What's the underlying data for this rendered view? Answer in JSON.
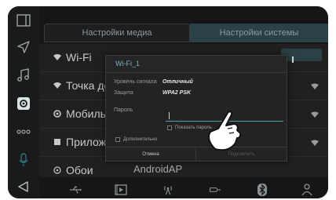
{
  "tabs": {
    "media": "Настройки медиа",
    "system": "Настройки системы"
  },
  "settings_list": {
    "items": [
      {
        "label": "Wi-Fi"
      },
      {
        "label": "Точка до"
      },
      {
        "label": "Мобильн"
      },
      {
        "label": "Приложе"
      },
      {
        "label": "Обои"
      }
    ],
    "network_name": "AndroidAP"
  },
  "dialog": {
    "title": "Wi-Fi_1",
    "signal_label": "Уровень сигнала",
    "signal_value": "Отличный",
    "security_label": "Защита",
    "security_value": "WPA2 PSK",
    "password_label": "Пароль",
    "password_value": "",
    "show_password_label": "Показать пароль",
    "advanced_label": "Дополнительно",
    "cancel_label": "Отмена",
    "connect_label": "Подключить"
  },
  "colors": {
    "accent": "#4ea0b3",
    "active_tab": "#2a4245",
    "background": "#161616"
  },
  "rail_icons": [
    "window-icon",
    "navigation-icon",
    "music-icon",
    "settings-gear-icon",
    "more-dots-icon",
    "microphone-icon",
    "back-icon"
  ],
  "bottom_icons": [
    "usb-icon",
    "video-icon",
    "radio-icon",
    "hdmi-icon",
    "bluetooth-icon",
    "user-icon"
  ]
}
